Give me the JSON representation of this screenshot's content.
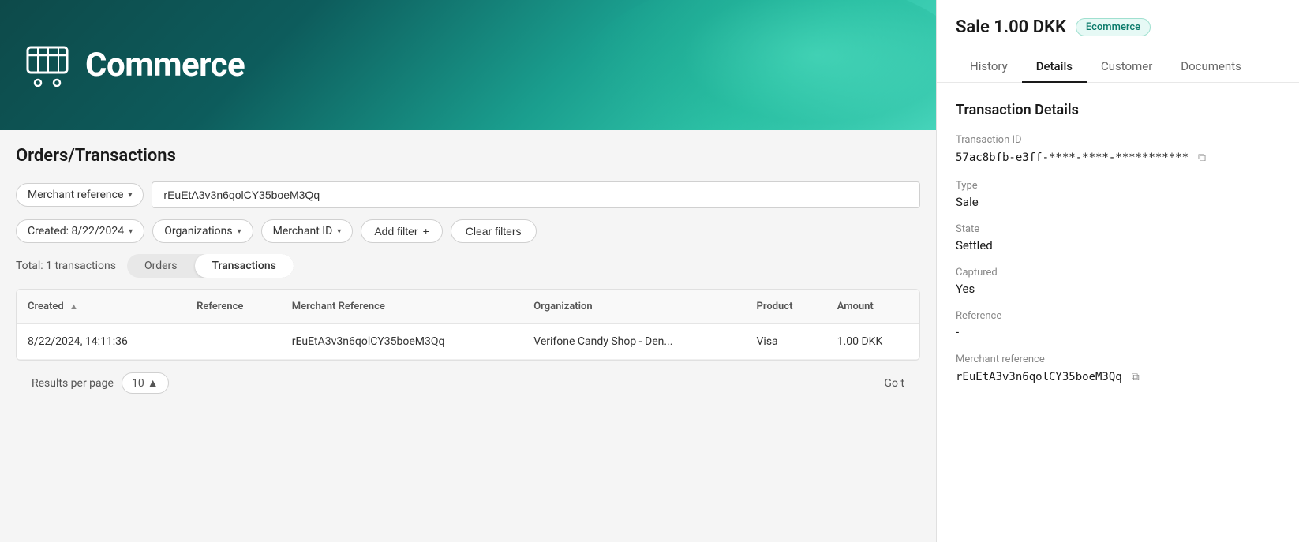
{
  "header": {
    "title": "Commerce",
    "cart_icon_alt": "cart-icon"
  },
  "page": {
    "title": "Orders/Transactions"
  },
  "filters": {
    "merchant_reference_label": "Merchant reference",
    "merchant_reference_value": "rEuEtA3v3n6qolCY35boeM3Qq",
    "created_label": "Created: 8/22/2024",
    "organizations_label": "Organizations",
    "merchant_id_label": "Merchant ID",
    "add_filter_label": "Add filter",
    "clear_filters_label": "Clear filters"
  },
  "table": {
    "total_text": "Total: 1 transactions",
    "tabs": [
      {
        "label": "Orders",
        "active": false
      },
      {
        "label": "Transactions",
        "active": true
      }
    ],
    "columns": [
      {
        "label": "Created",
        "sortable": true
      },
      {
        "label": "Reference",
        "sortable": false
      },
      {
        "label": "Merchant Reference",
        "sortable": false
      },
      {
        "label": "Organization",
        "sortable": false
      },
      {
        "label": "Product",
        "sortable": false
      },
      {
        "label": "Amount",
        "sortable": false
      }
    ],
    "rows": [
      {
        "created": "8/22/2024, 14:11:36",
        "reference": "",
        "merchant_reference": "rEuEtA3v3n6qolCY35boeM3Qq",
        "organization": "Verifone Candy Shop - Den...",
        "product": "Visa",
        "amount": "1.00 DKK"
      }
    ]
  },
  "footer": {
    "results_per_page_label": "Results per page",
    "per_page_value": "10",
    "go_to_label": "Go t"
  },
  "right_panel": {
    "title": "Sale 1.00 DKK",
    "badge": "Ecommerce",
    "nav_items": [
      {
        "label": "History",
        "active": false
      },
      {
        "label": "Details",
        "active": true
      },
      {
        "label": "Customer",
        "active": false
      },
      {
        "label": "Documents",
        "active": false
      }
    ],
    "section_title": "Transaction Details",
    "details": {
      "transaction_id_label": "Transaction ID",
      "transaction_id_value": "57ac8bfb-e3ff-****-****-***********",
      "type_label": "Type",
      "type_value": "Sale",
      "state_label": "State",
      "state_value": "Settled",
      "captured_label": "Captured",
      "captured_value": "Yes",
      "reference_label": "Reference",
      "reference_value": "-",
      "merchant_reference_label": "Merchant reference",
      "merchant_reference_value": "rEuEtA3v3n6qolCY35boeM3Qq"
    }
  }
}
